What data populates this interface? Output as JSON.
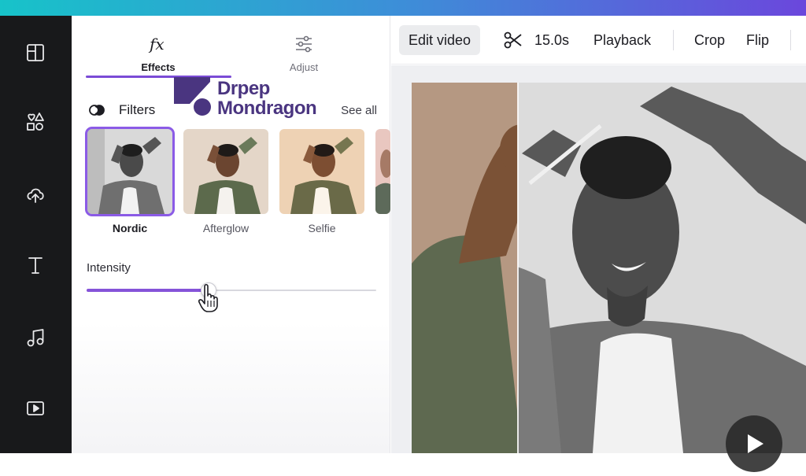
{
  "sidebar_rail": {
    "items": [
      {
        "icon": "layout-template-icon"
      },
      {
        "icon": "elements-shapes-icon"
      },
      {
        "icon": "cloud-upload-icon"
      },
      {
        "icon": "text-icon"
      },
      {
        "icon": "music-note-icon"
      },
      {
        "icon": "video-play-icon"
      }
    ]
  },
  "panel": {
    "tabs": [
      {
        "label": "Effects",
        "icon": "fx-icon",
        "active": true
      },
      {
        "label": "Adjust",
        "icon": "sliders-icon",
        "active": false
      }
    ],
    "filters": {
      "title": "Filters",
      "see_all": "See all",
      "items": [
        {
          "label": "Nordic",
          "selected": true
        },
        {
          "label": "Afterglow",
          "selected": false
        },
        {
          "label": "Selfie",
          "selected": false
        }
      ]
    },
    "intensity": {
      "label": "Intensity",
      "value_fraction": 0.42
    }
  },
  "brand_overlay": {
    "line1": "Drpep",
    "line2": "Mondragon"
  },
  "toolbar": {
    "edit_video": "Edit video",
    "duration": "15.0s",
    "playback": "Playback",
    "crop": "Crop",
    "flip": "Flip"
  },
  "colors": {
    "accent": "#8553d9",
    "rail_bg": "#18191b",
    "brand": "#4a3580"
  }
}
